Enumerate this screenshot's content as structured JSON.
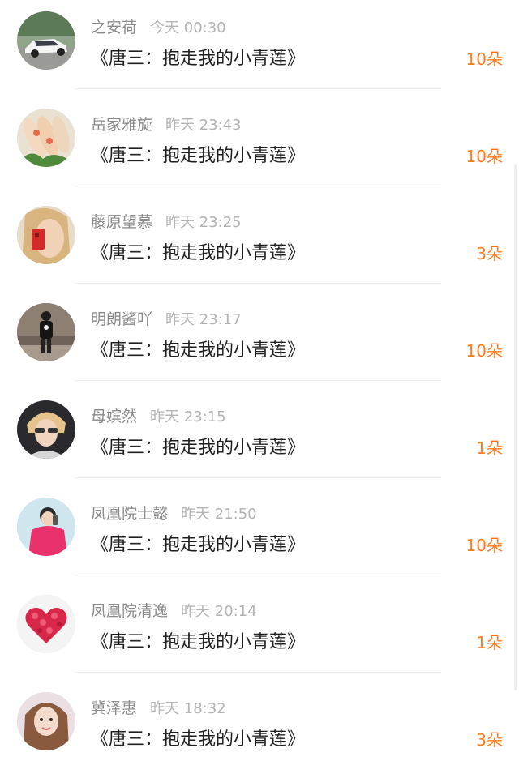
{
  "gifts": [
    {
      "name": "之安荷",
      "time": "今天 00:30",
      "gift": "《唐三：抱走我的小青莲》",
      "count": "10朵"
    },
    {
      "name": "岳家雅旋",
      "time": "昨天 23:43",
      "gift": "《唐三：抱走我的小青莲》",
      "count": "10朵"
    },
    {
      "name": "藤原望慕",
      "time": "昨天 23:25",
      "gift": "《唐三：抱走我的小青莲》",
      "count": "3朵"
    },
    {
      "name": "明朗酱吖",
      "time": "昨天 23:17",
      "gift": "《唐三：抱走我的小青莲》",
      "count": "10朵"
    },
    {
      "name": "母嫔然",
      "time": "昨天 23:15",
      "gift": "《唐三：抱走我的小青莲》",
      "count": "1朵"
    },
    {
      "name": "凤凰院士懿",
      "time": "昨天 21:50",
      "gift": "《唐三：抱走我的小青莲》",
      "count": "10朵"
    },
    {
      "name": "凤凰院清逸",
      "time": "昨天 20:14",
      "gift": "《唐三：抱走我的小青莲》",
      "count": "1朵"
    },
    {
      "name": "冀泽惠",
      "time": "昨天 18:32",
      "gift": "《唐三：抱走我的小青莲》",
      "count": "3朵"
    }
  ],
  "colors": {
    "accent": "#ff7a1a",
    "name": "#8a8a8a",
    "time": "#b3b3b3",
    "text": "#1f1f1f"
  }
}
